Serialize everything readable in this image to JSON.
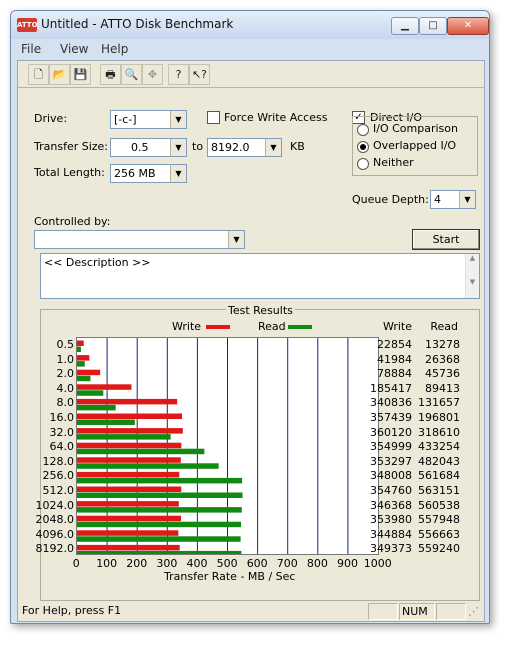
{
  "window": {
    "title": "Untitled - ATTO Disk Benchmark",
    "app_icon_text": "ATTO",
    "buttons": {
      "minimize": "▁",
      "maximize": "□",
      "close": "✕"
    }
  },
  "menu": [
    "File",
    "View",
    "Help"
  ],
  "toolbar": [
    "new-icon",
    "open-icon",
    "save-icon",
    "print-icon",
    "print-preview-icon",
    "move-icon",
    "help-icon",
    "context-help-icon"
  ],
  "form": {
    "drive_label": "Drive:",
    "drive_value": "[-c-]",
    "force_write_label": "Force Write Access",
    "force_write_checked": false,
    "direct_io_label": "Direct I/O",
    "direct_io_checked": true,
    "transfer_size_label": "Transfer Size:",
    "transfer_from": "0.5",
    "to_label": "to",
    "transfer_to": "8192.0",
    "kb_label": "KB",
    "total_length_label": "Total Length:",
    "total_length_value": "256 MB",
    "io_comparison_label": "I/O Comparison",
    "overlapped_io_label": "Overlapped I/O",
    "neither_label": "Neither",
    "selected_mode": "Overlapped I/O",
    "queue_depth_label": "Queue Depth:",
    "queue_depth_value": "4",
    "controlled_by_label": "Controlled by:",
    "controlled_by_value": "",
    "start_label": "Start",
    "description_text": "<< Description >>"
  },
  "results": {
    "group_title": "Test Results",
    "write_legend": "Write",
    "read_legend": "Read",
    "write_col": "Write",
    "read_col": "Read"
  },
  "colors": {
    "write": "#e01818",
    "read": "#118a11",
    "grid": "#22227a"
  },
  "chart_data": {
    "type": "bar",
    "orientation": "horizontal",
    "categories": [
      "0.5",
      "1.0",
      "2.0",
      "4.0",
      "8.0",
      "16.0",
      "32.0",
      "64.0",
      "128.0",
      "256.0",
      "512.0",
      "1024.0",
      "2048.0",
      "4096.0",
      "8192.0"
    ],
    "series": [
      {
        "name": "Write",
        "values": [
          22854,
          41984,
          78884,
          185417,
          340836,
          357439,
          360120,
          354999,
          353297,
          348008,
          354760,
          346368,
          353980,
          344884,
          349373
        ]
      },
      {
        "name": "Read",
        "values": [
          13278,
          26368,
          45736,
          89413,
          131657,
          196801,
          318610,
          433254,
          482043,
          561684,
          563151,
          560538,
          557948,
          556663,
          559240
        ]
      }
    ],
    "x_ticks": [
      "0",
      "100",
      "200",
      "300",
      "400",
      "500",
      "600",
      "700",
      "800",
      "900",
      "1000"
    ],
    "xlim": [
      0,
      1000
    ],
    "xlabel": "Transfer Rate - MB / Sec",
    "grid": true,
    "legend": "top-center"
  },
  "status": {
    "help_text": "For Help, press F1",
    "num": "NUM"
  }
}
